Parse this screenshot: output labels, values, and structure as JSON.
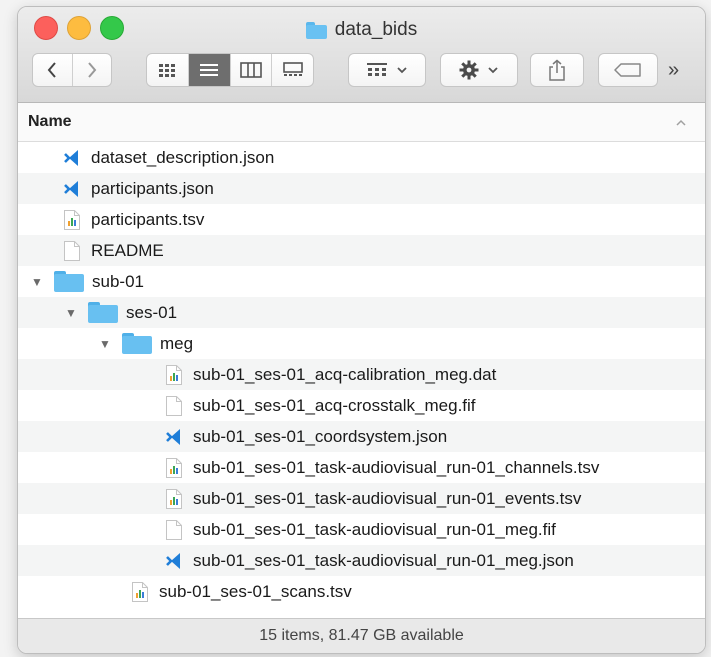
{
  "window": {
    "title": "data_bids"
  },
  "toolbar": {
    "back_icon": "chevron-left-icon",
    "forward_icon": "chevron-right-icon",
    "view_modes": [
      "icon-view-icon",
      "list-view-icon",
      "column-view-icon",
      "gallery-view-icon"
    ],
    "active_view": "list-view-icon",
    "group_icon": "group-by-icon",
    "action_icon": "gear-icon",
    "share_icon": "share-icon",
    "tag_icon": "tag-icon",
    "overflow_label": "»"
  },
  "header": {
    "name_label": "Name",
    "sort_indicator": "^"
  },
  "files": [
    {
      "name": "dataset_description.json",
      "icon": "vscode-json-icon",
      "level": 0,
      "expander": ""
    },
    {
      "name": "participants.json",
      "icon": "vscode-json-icon",
      "level": 0,
      "expander": ""
    },
    {
      "name": "participants.tsv",
      "icon": "tsv-chart-icon",
      "level": 0,
      "expander": ""
    },
    {
      "name": "README",
      "icon": "blank-document-icon",
      "level": 0,
      "expander": ""
    },
    {
      "name": "sub-01",
      "icon": "folder-icon",
      "level": 0,
      "expander": "▼"
    },
    {
      "name": "ses-01",
      "icon": "folder-icon",
      "level": 1,
      "expander": "▼"
    },
    {
      "name": "meg",
      "icon": "folder-icon",
      "level": 2,
      "expander": "▼"
    },
    {
      "name": "sub-01_ses-01_acq-calibration_meg.dat",
      "icon": "tsv-chart-icon",
      "level": 3,
      "expander": ""
    },
    {
      "name": "sub-01_ses-01_acq-crosstalk_meg.fif",
      "icon": "blank-document-icon",
      "level": 3,
      "expander": ""
    },
    {
      "name": "sub-01_ses-01_coordsystem.json",
      "icon": "vscode-json-icon",
      "level": 3,
      "expander": ""
    },
    {
      "name": "sub-01_ses-01_task-audiovisual_run-01_channels.tsv",
      "icon": "tsv-chart-icon",
      "level": 3,
      "expander": ""
    },
    {
      "name": "sub-01_ses-01_task-audiovisual_run-01_events.tsv",
      "icon": "tsv-chart-icon",
      "level": 3,
      "expander": ""
    },
    {
      "name": "sub-01_ses-01_task-audiovisual_run-01_meg.fif",
      "icon": "blank-document-icon",
      "level": 3,
      "expander": ""
    },
    {
      "name": "sub-01_ses-01_task-audiovisual_run-01_meg.json",
      "icon": "vscode-json-icon",
      "level": 3,
      "expander": ""
    },
    {
      "name": "sub-01_ses-01_scans.tsv",
      "icon": "tsv-chart-icon",
      "level": 2,
      "expander": ""
    }
  ],
  "status": {
    "text": "15 items, 81.47 GB available"
  },
  "colors": {
    "folder": "#68c0f1",
    "vscode_blue": "#1f7ed8",
    "traffic_red": "#fc605c",
    "traffic_yellow": "#fdbc40",
    "traffic_green": "#34c84a"
  }
}
